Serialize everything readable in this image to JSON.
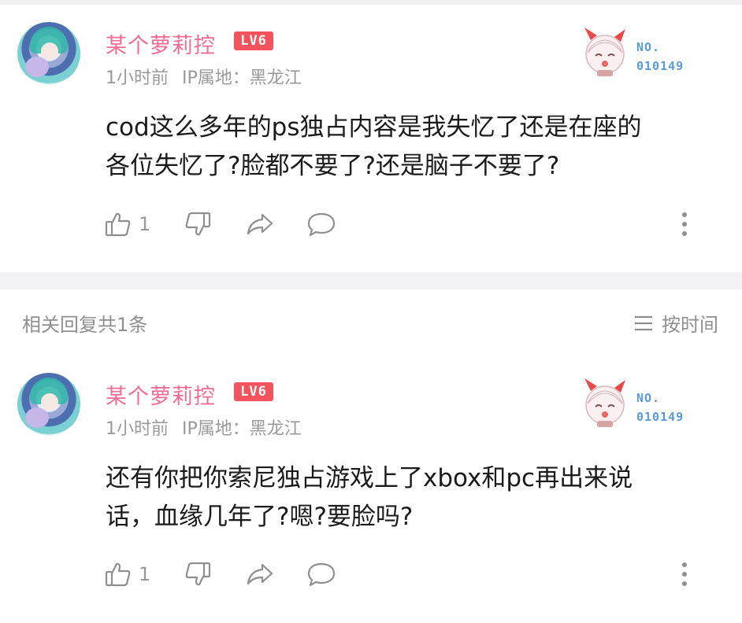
{
  "comments": [
    {
      "username": "某个萝莉控",
      "level": "LV6",
      "time": "1小时前",
      "ip_location": "IP属地：黑龙江",
      "no_label": "NO.",
      "no_number": "010149",
      "content_line1": "cod这么多年的ps独占内容是我失忆了还是在座的",
      "content_line2": "各位失忆了?脸都不要了?还是脑子不要了?",
      "like_count": "1"
    },
    {
      "username": "某个萝莉控",
      "level": "LV6",
      "time": "1小时前",
      "ip_location": "IP属地：黑龙江",
      "no_label": "NO.",
      "no_number": "010149",
      "content_line1": "还有你把你索尼独占游戏上了xbox和pc再出来说",
      "content_line2": "话，血缘几年了?嗯?要脸吗?",
      "like_count": "1"
    }
  ],
  "replies": {
    "header": "相关回复共1条",
    "sort_label": "按时间"
  },
  "colors": {
    "username": "#f36b93",
    "level_badge": "#f4525d",
    "no_badge": "#5a9ad6",
    "muted": "#9a9a9a"
  },
  "icons": [
    "thumb-up-icon",
    "thumb-down-icon",
    "share-icon",
    "comment-icon",
    "more-icon",
    "sort-icon"
  ]
}
